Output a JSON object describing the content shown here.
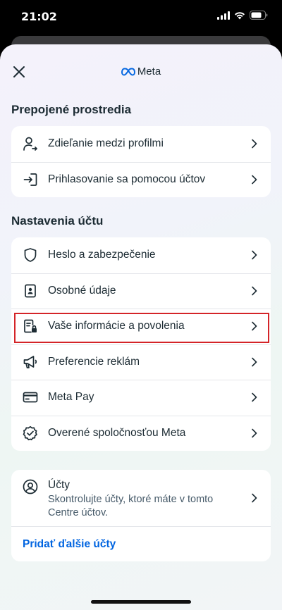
{
  "status_bar": {
    "time": "21:02"
  },
  "header": {
    "logo_text": "Meta"
  },
  "connected_section": {
    "title": "Prepojené prostredia",
    "items": [
      {
        "label": "Zdieľanie medzi profilmi",
        "icon": "profile-sharing-icon"
      },
      {
        "label": "Prihlasovanie sa pomocou účtov",
        "icon": "login-arrow-icon"
      }
    ]
  },
  "account_settings_section": {
    "title": "Nastavenia účtu",
    "items": [
      {
        "label": "Heslo a zabezpečenie",
        "icon": "shield-icon"
      },
      {
        "label": "Osobné údaje",
        "icon": "id-card-icon"
      },
      {
        "label": "Vaše informácie a povolenia",
        "icon": "info-lock-icon",
        "highlighted": true
      },
      {
        "label": "Preferencie reklám",
        "icon": "megaphone-icon"
      },
      {
        "label": "Meta Pay",
        "icon": "credit-card-icon"
      },
      {
        "label": "Overené spoločnosťou Meta",
        "icon": "verified-badge-icon"
      }
    ]
  },
  "accounts_card": {
    "title": "Účty",
    "description": "Skontrolujte účty, ktoré máte v tomto Centre účtov.",
    "add_link": "Pridať ďalšie účty"
  },
  "colors": {
    "link": "#0064e0",
    "highlight": "#d42428",
    "text": "#1c2b33"
  }
}
